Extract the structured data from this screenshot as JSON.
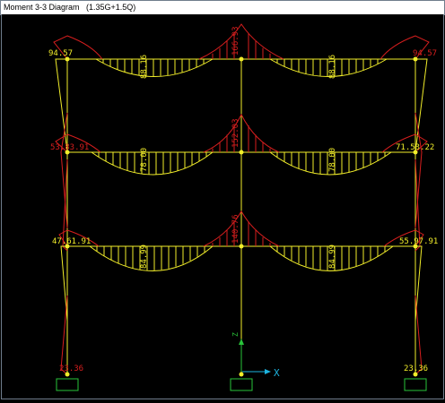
{
  "window": {
    "title": "Moment 3-3 Diagram   (1.35G+1.5Q)"
  },
  "axes": {
    "x_label": "X",
    "z_label": "Z"
  },
  "colors": {
    "frame": "#f2ee2a",
    "hogging": "#d81e1e",
    "sagging": "#f2ee2a",
    "support": "#29c43a",
    "axis": "#1db3df"
  },
  "moments": {
    "roof": {
      "left_end": "94.57",
      "center_top": "166.93",
      "right_end": "94.57",
      "span_left": "88.16",
      "span_right": "88.16"
    },
    "level2": {
      "left_end": "53.83.91",
      "center_top": "152.03",
      "right_end": "71.53.22",
      "span_left": "78.00",
      "span_right": "78.00"
    },
    "level1": {
      "left_end": "47.61.91",
      "center_top": "140.76",
      "right_end": "55.97.91",
      "span_left": "84.99",
      "span_right": "84.99"
    },
    "base": {
      "left": "23.36",
      "right": "23.36"
    }
  }
}
